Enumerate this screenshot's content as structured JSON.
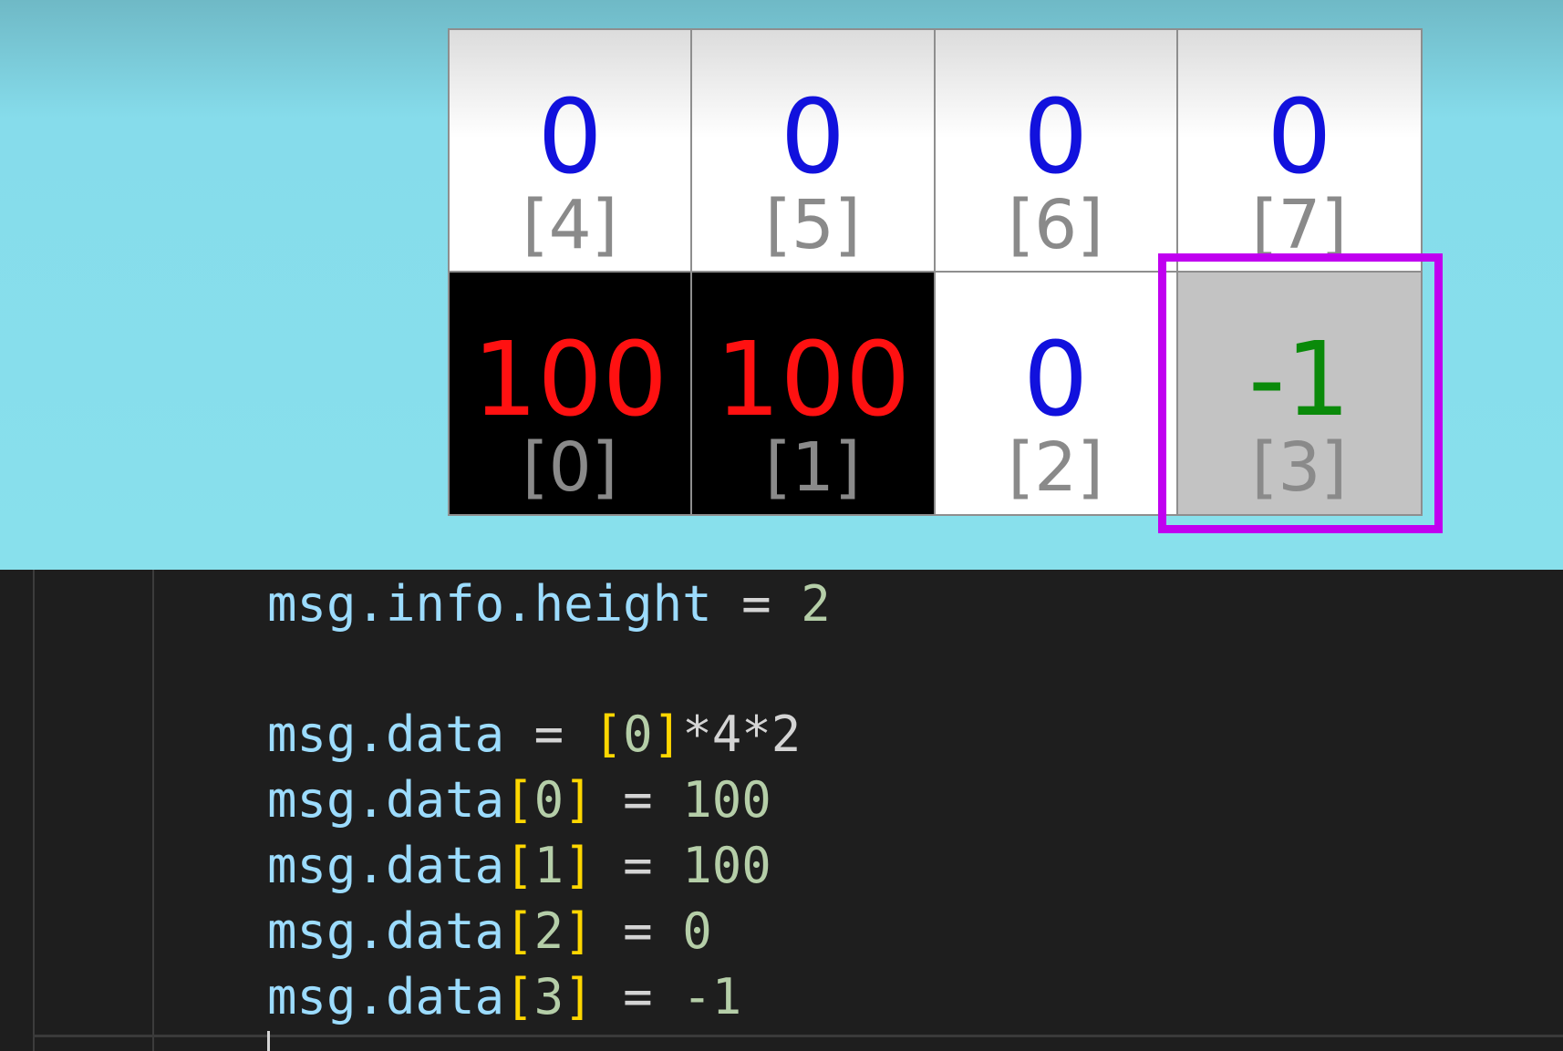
{
  "grid": {
    "rows": [
      {
        "cells": [
          {
            "value": "0",
            "index": "[4]",
            "state": "free"
          },
          {
            "value": "0",
            "index": "[5]",
            "state": "free"
          },
          {
            "value": "0",
            "index": "[6]",
            "state": "free"
          },
          {
            "value": "0",
            "index": "[7]",
            "state": "free"
          }
        ]
      },
      {
        "cells": [
          {
            "value": "100",
            "index": "[0]",
            "state": "occupied"
          },
          {
            "value": "100",
            "index": "[1]",
            "state": "occupied"
          },
          {
            "value": "0",
            "index": "[2]",
            "state": "free"
          },
          {
            "value": "-1",
            "index": "[3]",
            "state": "unknown"
          }
        ]
      }
    ],
    "highlighted_cell_index": "[3]",
    "colors": {
      "free_value": "#1111dd",
      "occupied_value": "#ff1111",
      "unknown_value": "#0a8a0a",
      "index_label": "#8a8a8a",
      "highlight": "#c000f0",
      "background": "#88e0ec"
    }
  },
  "code": {
    "lines": [
      {
        "var": "msg.info.height",
        "op": " = ",
        "num": "2"
      },
      {
        "var": "msg.data",
        "op": " = ",
        "bracket_open": "[",
        "inner": "0",
        "bracket_close": "]",
        "tail": "*4*2"
      },
      {
        "var": "msg.data",
        "bracket_open": "[",
        "inner": "0",
        "bracket_close": "]",
        "op": " = ",
        "num": "100"
      },
      {
        "var": "msg.data",
        "bracket_open": "[",
        "inner": "1",
        "bracket_close": "]",
        "op": " = ",
        "num": "100"
      },
      {
        "var": "msg.data",
        "bracket_open": "[",
        "inner": "2",
        "bracket_close": "]",
        "op": " = ",
        "num": "0"
      },
      {
        "var": "msg.data",
        "bracket_open": "[",
        "inner": "3",
        "bracket_close": "]",
        "op": " = ",
        "num": "-1"
      }
    ],
    "colors": {
      "background": "#1e1e1e",
      "variable": "#9cdcfe",
      "number": "#b5cea8",
      "bracket": "#ffd700"
    }
  }
}
